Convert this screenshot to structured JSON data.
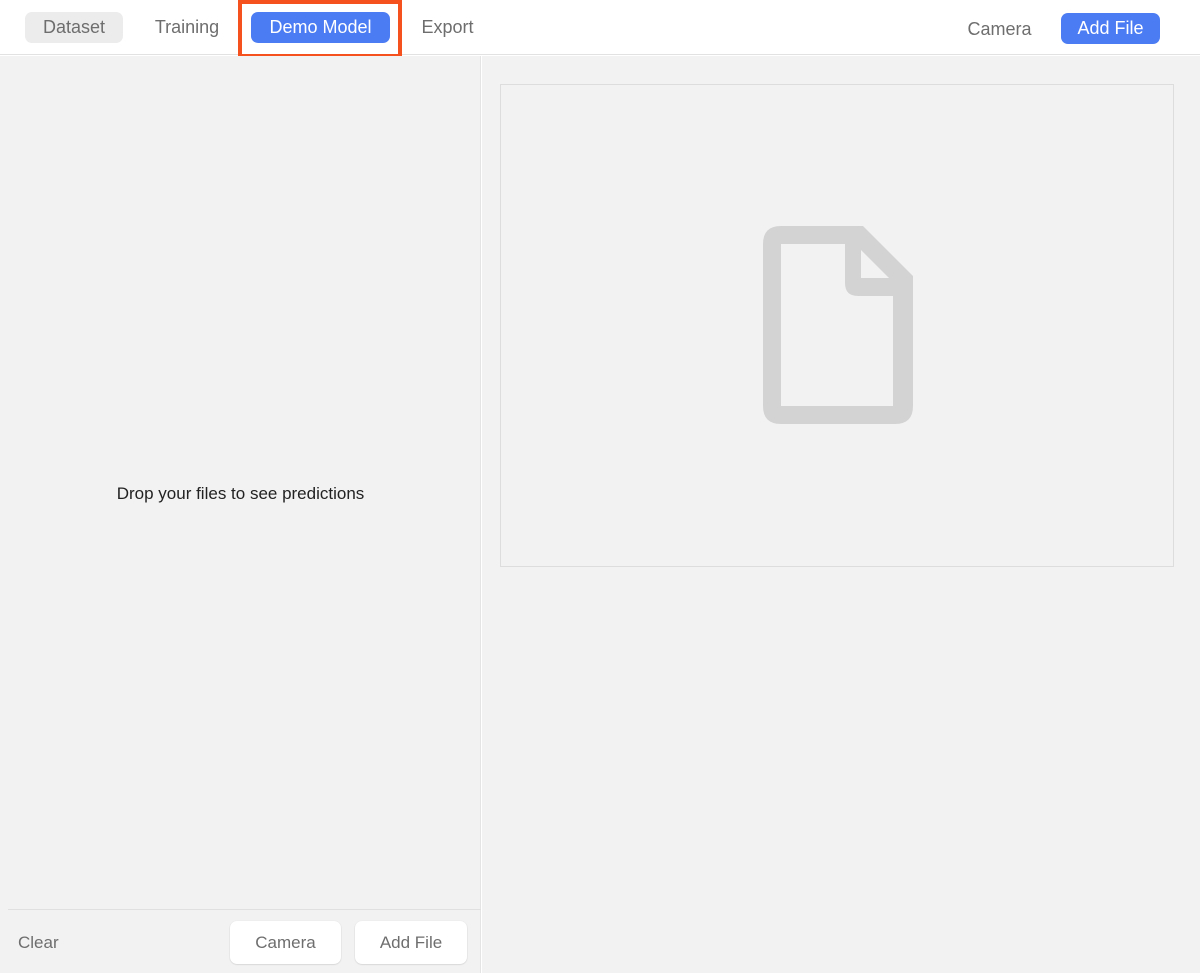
{
  "tabs": [
    {
      "label": "Dataset"
    },
    {
      "label": "Training"
    },
    {
      "label": "Demo Model"
    },
    {
      "label": "Export"
    }
  ],
  "active_tab": "Demo Model",
  "toolbar": {
    "camera_label": "Camera",
    "add_file_label": "Add File"
  },
  "left_panel": {
    "drop_hint": "Drop your files to see predictions",
    "clear_label": "Clear",
    "camera_label": "Camera",
    "add_file_label": "Add File"
  },
  "preview": {
    "icon": "document-icon"
  },
  "colors": {
    "accent": "#4c7cf3",
    "highlight": "#f4511e",
    "panel_bg": "#f2f2f2",
    "icon_gray": "#d3d3d3"
  }
}
